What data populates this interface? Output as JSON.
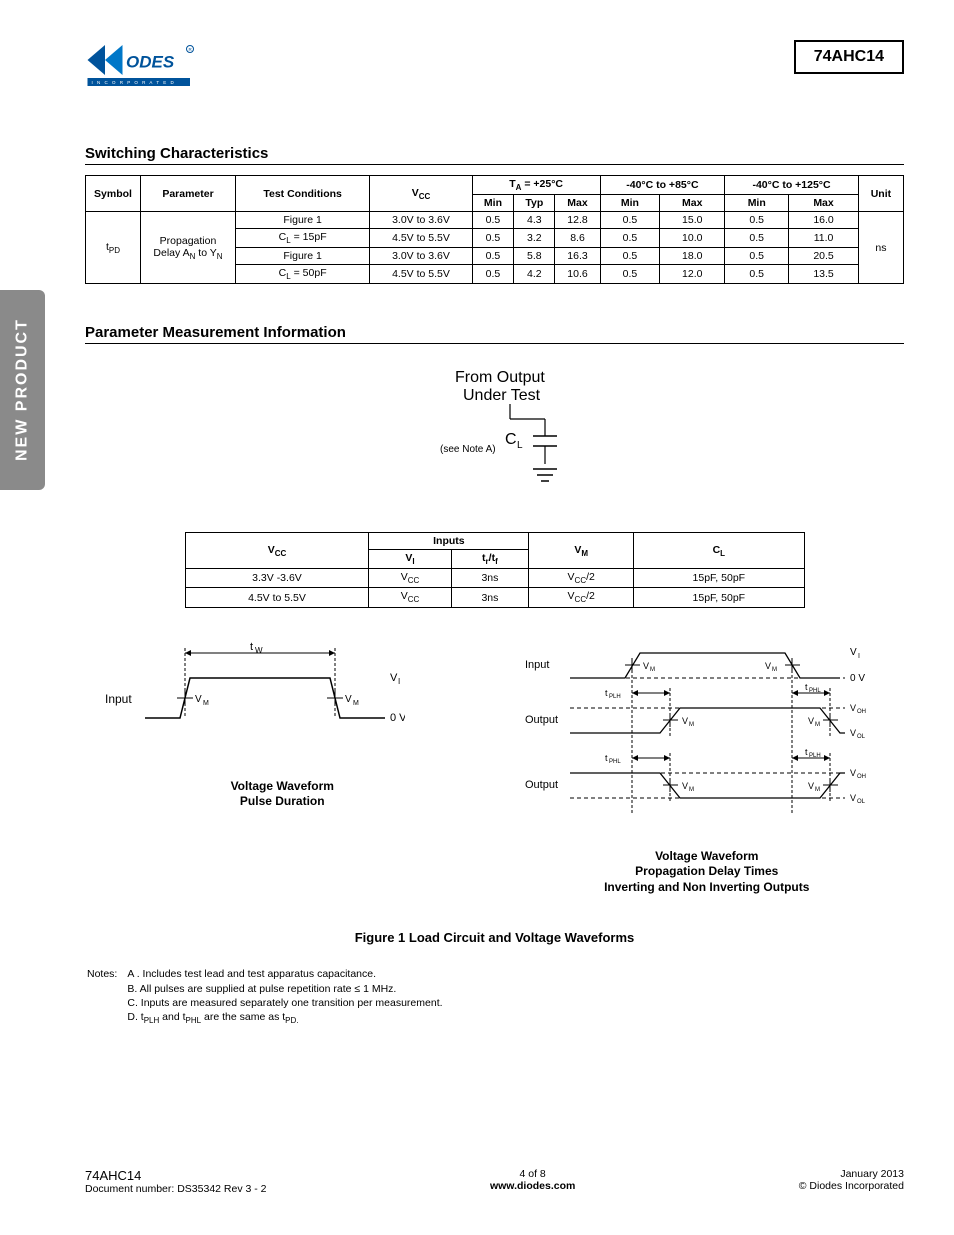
{
  "sidebar": {
    "label": "NEW PRODUCT"
  },
  "part_number": "74AHC14",
  "section1": {
    "title": "Switching Characteristics"
  },
  "table1": {
    "headers": {
      "symbol": "Symbol",
      "parameter": "Parameter",
      "test": "Test Conditions",
      "vcc": "V",
      "vcc_sub": "CC",
      "ta25": "T",
      "ta25_sub": "A",
      "ta25_suffix": " = +25°C",
      "t85": "-40°C to +85°C",
      "t125": "-40°C to +125°C",
      "unit": "Unit",
      "min": "Min",
      "typ": "Typ",
      "max": "Max"
    },
    "symbol": "t",
    "symbol_sub": "PD",
    "param_l1": "Propagation",
    "param_l2a": "Delay A",
    "param_l2n": "N",
    "param_l2b": " to Y",
    "cond": {
      "fig": "Figure 1",
      "cl15a": "C",
      "cl15b": "L",
      "cl15c": " = 15pF",
      "cl50a": "C",
      "cl50b": "L",
      "cl50c": " = 50pF"
    },
    "rows": [
      {
        "vcc": "3.0V to 3.6V",
        "min25": "0.5",
        "typ25": "4.3",
        "max25": "12.8",
        "min85": "0.5",
        "max85": "15.0",
        "min125": "0.5",
        "max125": "16.0"
      },
      {
        "vcc": "4.5V to 5.5V",
        "min25": "0.5",
        "typ25": "3.2",
        "max25": "8.6",
        "min85": "0.5",
        "max85": "10.0",
        "min125": "0.5",
        "max125": "11.0"
      },
      {
        "vcc": "3.0V to 3.6V",
        "min25": "0.5",
        "typ25": "5.8",
        "max25": "16.3",
        "min85": "0.5",
        "max85": "18.0",
        "min125": "0.5",
        "max125": "20.5"
      },
      {
        "vcc": "4.5V to 5.5V",
        "min25": "0.5",
        "typ25": "4.2",
        "max25": "10.6",
        "min85": "0.5",
        "max85": "12.0",
        "min125": "0.5",
        "max125": "13.5"
      }
    ],
    "unit_val": "ns"
  },
  "section2": {
    "title": "Parameter Measurement Information"
  },
  "circuit": {
    "line1": "From Output",
    "line2": "Under Test",
    "cl": "C",
    "cl_sub": "L",
    "note": "(see Note A)"
  },
  "table2": {
    "vcc": "V",
    "vcc_sub": "CC",
    "inputs": "Inputs",
    "vi": "V",
    "vi_sub": "I",
    "trtf": "t",
    "trtf_sub1": "r",
    "trtf_mid": "/t",
    "trtf_sub2": "f",
    "vm": "V",
    "vm_sub": "M",
    "cl": "C",
    "cl_sub": "L",
    "rows": [
      {
        "vcc": "3.3V -3.6V",
        "vi": "V",
        "vi_sub": "CC",
        "trtf": "3ns",
        "vm": "V",
        "vm_sub": "CC",
        "vm_suf": "/2",
        "cl": "15pF, 50pF"
      },
      {
        "vcc": "4.5V to 5.5V",
        "vi": "V",
        "vi_sub": "CC",
        "trtf": "3ns",
        "vm": "V",
        "vm_sub": "CC",
        "vm_suf": "/2",
        "cl": "15pF, 50pF"
      }
    ]
  },
  "wave1": {
    "caption_l1": "Voltage Waveform",
    "caption_l2": "Pulse Duration"
  },
  "wave2": {
    "caption_l1": "Voltage Waveform",
    "caption_l2": "Propagation Delay Times",
    "caption_l3": "Inverting and Non Inverting Outputs"
  },
  "figure_title": "Figure 1 Load Circuit and Voltage Waveforms",
  "notes": {
    "label": "Notes:",
    "a": "A . Includes test lead and test apparatus capacitance.",
    "b": "B.  All pulses are supplied at pulse repetition rate ≤ 1 MHz.",
    "c": "C.  Inputs are measured separately one transition per measurement.",
    "d_pre": "D.  t",
    "d_s1": "PLH",
    "d_mid": " and t",
    "d_s2": "PHL",
    "d_mid2": " are the same as t",
    "d_s3": "PD."
  },
  "footer": {
    "left_l1": "74AHC14",
    "left_l2": "Document number: DS35342 Rev  3 - 2",
    "mid_l1": "4 of 8",
    "mid_l2": "www.diodes.com",
    "right_l1": "January 2013",
    "right_l2": "© Diodes Incorporated"
  },
  "logo_tag": "I N C O R P O R A T E D"
}
